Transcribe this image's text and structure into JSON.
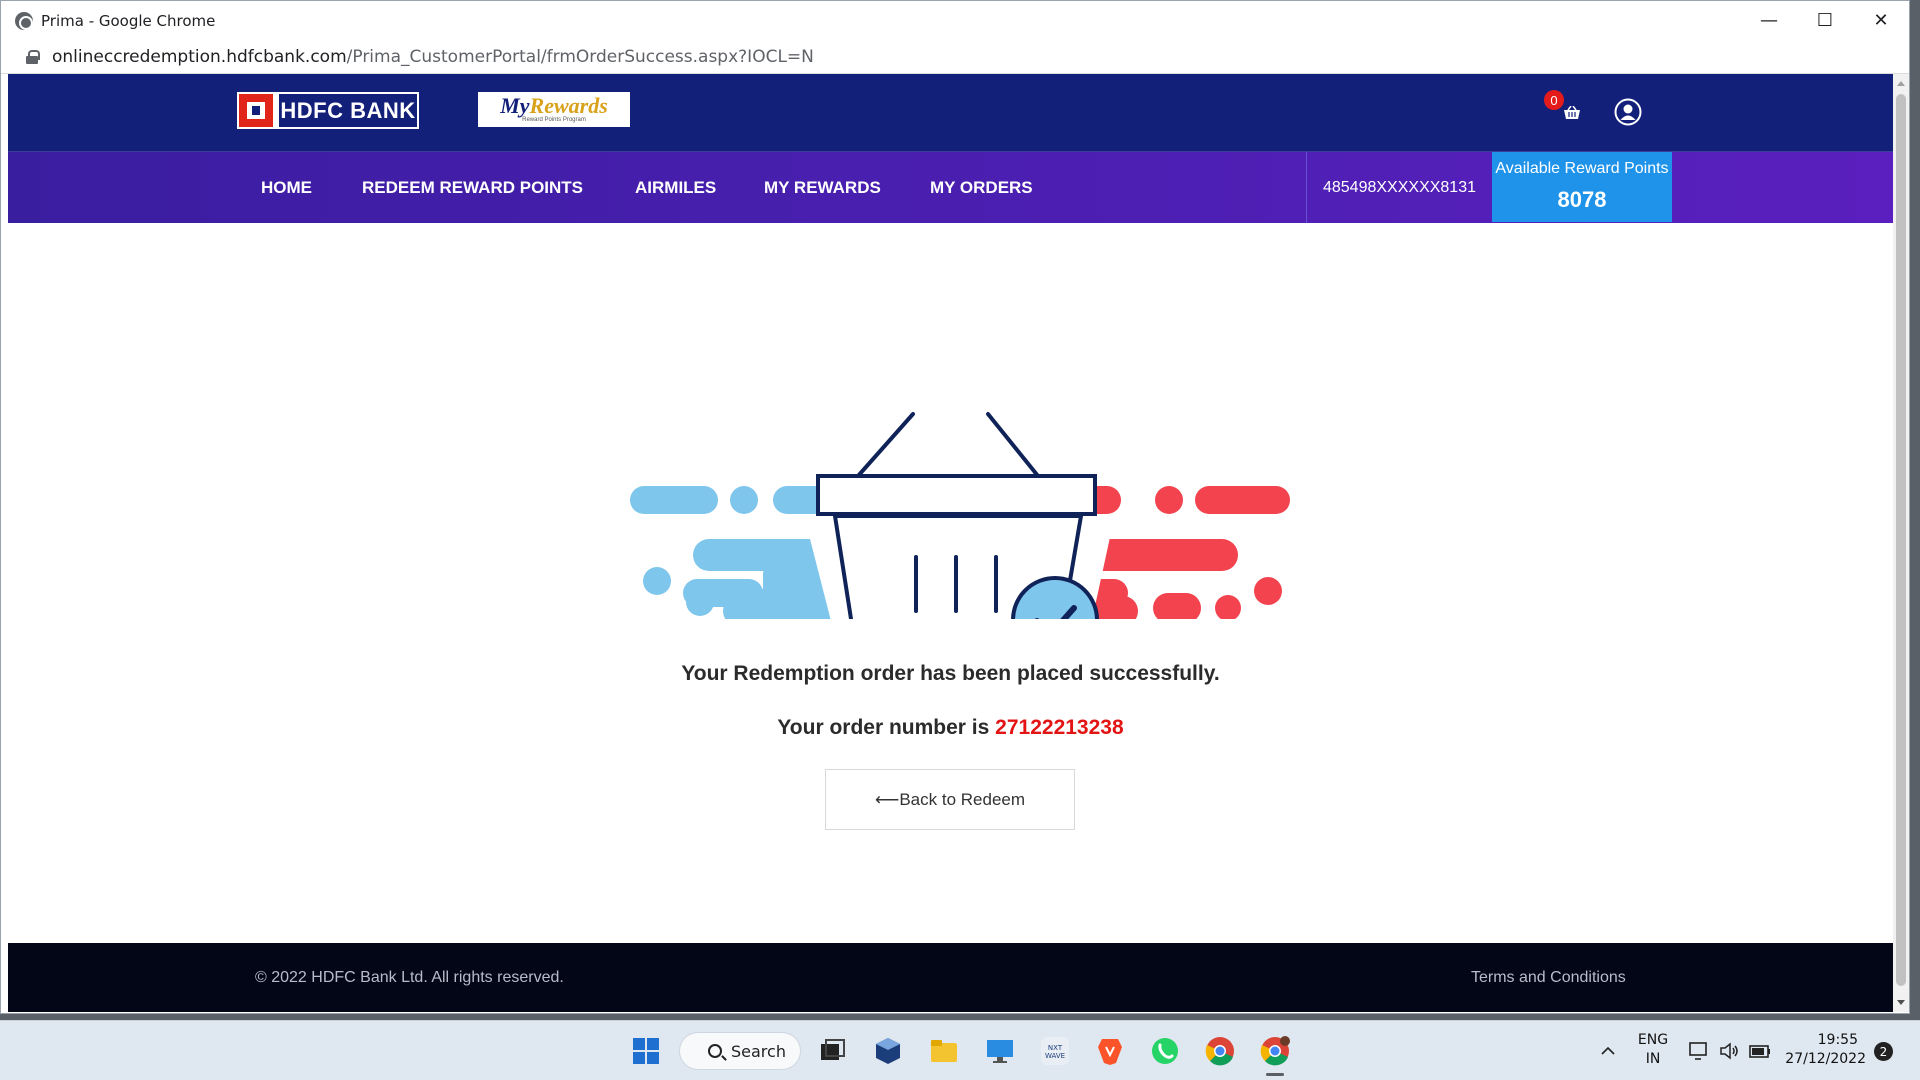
{
  "browser": {
    "window_title": "Prima - Google Chrome",
    "url_host": "onlineccredemption.hdfcbank.com",
    "url_path": "/Prima_CustomerPortal/frmOrderSuccess.aspx?IOCL=N",
    "controls": {
      "minimize": "—",
      "maximize": "☐",
      "close": "✕"
    }
  },
  "header": {
    "bank_logo_text": "HDFC BANK",
    "rewards_logo_text_a": "My",
    "rewards_logo_text_b": "Rewards",
    "rewards_logo_sub": "Reward Points Program",
    "cart_count": "0",
    "icons": [
      "cart-icon",
      "user-icon"
    ]
  },
  "nav": {
    "items": [
      {
        "label": "HOME"
      },
      {
        "label": "REDEEM REWARD POINTS"
      },
      {
        "label": "AIRMILES"
      },
      {
        "label": "MY REWARDS"
      },
      {
        "label": "MY ORDERS"
      }
    ],
    "card_number": "485498XXXXXX8131",
    "reward_label": "Available Reward Points",
    "reward_points": "8078"
  },
  "content": {
    "success_message": "Your Redemption order has been placed successfully.",
    "order_prefix": "Your order number is",
    "order_number": "27122213238",
    "back_button": "⟵Back to Redeem",
    "illustration_icon": "shopping-basket-check-icon"
  },
  "footer": {
    "copyright": "© 2022 HDFC Bank Ltd. All rights reserved.",
    "terms": "Terms and Conditions"
  },
  "taskbar": {
    "search_label": "Search",
    "lang_1": "ENG",
    "lang_2": "IN",
    "time": "19:55",
    "date": "27/12/2022",
    "notification_count": "2",
    "apps": [
      "windows-start-icon",
      "search-icon",
      "task-view-icon",
      "virtualbox-icon",
      "file-explorer-icon",
      "remote-desktop-icon",
      "nxtwave-icon",
      "brave-browser-icon",
      "whatsapp-icon",
      "chrome-icon",
      "chrome-profile-icon"
    ]
  },
  "colors": {
    "header_navy": "#13207a",
    "nav_purple": "#4a1fb0",
    "reward_blue": "#1f93ea",
    "order_red": "#e31414",
    "footer_bg": "#020617",
    "illus_blue": "#7fc6ec",
    "illus_red": "#f2434e"
  }
}
